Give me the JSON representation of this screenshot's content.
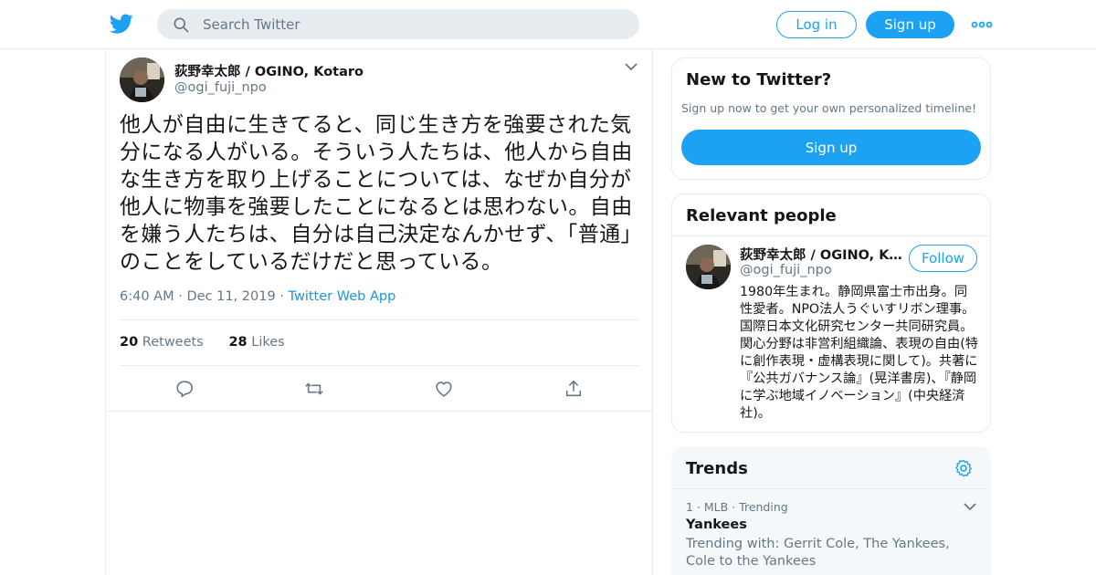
{
  "colors": {
    "brand": "#1da1f2",
    "link": "#1b95e0",
    "muted": "#657786",
    "border": "#e6ecf0"
  },
  "header": {
    "logo_icon": "twitter-bird-icon",
    "search": {
      "placeholder": "Search Twitter",
      "icon": "search-icon"
    },
    "login_label": "Log in",
    "signup_label": "Sign up",
    "more_icon": "more-dots-icon"
  },
  "tweet": {
    "author_name": "荻野幸太郎 / OGINO, Kotaro",
    "author_handle": "@ogi_fuji_npo",
    "text": "他人が自由に生きてると、同じ生き方を強要された気分になる人がいる。そういう人たちは、他人から自由な生き方を取り上げることについては、なぜか自分が他人に物事を強要したことになるとは思わない。自由を嫌う人たちは、自分は自己決定なんかせず、「普通」のことをしているだけだと思っている。",
    "time": "6:40 AM",
    "date": "Dec 11, 2019",
    "source": "Twitter Web App",
    "retweets_count": "20",
    "retweets_label": "Retweets",
    "likes_count": "28",
    "likes_label": "Likes",
    "actions": [
      "reply-icon",
      "retweet-icon",
      "like-icon",
      "share-icon"
    ]
  },
  "sidebar": {
    "new_to_twitter": {
      "title": "New to Twitter?",
      "subtitle": "Sign up now to get your own personalized timeline!",
      "signup_label": "Sign up"
    },
    "relevant_people": {
      "title": "Relevant people",
      "person": {
        "name": "荻野幸太郎 / OGINO, Kotaro",
        "handle": "@ogi_fuji_npo",
        "follow_label": "Follow",
        "bio": "1980年生まれ。静岡県富士市出身。同性愛者。NPO法人うぐいすリボン理事。国際日本文化研究センター共同研究員。関心分野は非営利組織論、表現の自由(特に創作表現・虚構表現に関して)。共著に『公共ガバナンス論』(晃洋書房)、『静岡に学ぶ地域イノベーション』(中央経済社)。"
      }
    },
    "trends": {
      "title": "Trends",
      "settings_icon": "gear-icon",
      "items": [
        {
          "rank": "1",
          "category": "MLB",
          "status": "Trending",
          "name": "Yankees",
          "trending_with": "Trending with: Gerrit Cole, The Yankees, Cole to the Yankees"
        }
      ]
    }
  }
}
